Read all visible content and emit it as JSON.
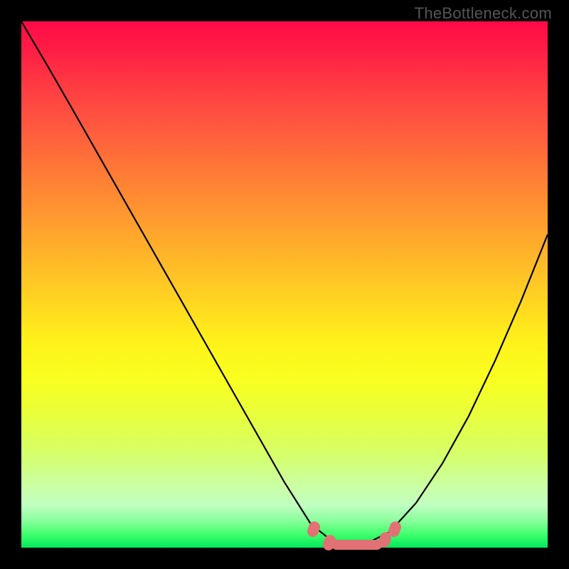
{
  "watermark": "TheBottleneck.com",
  "colors": {
    "page_bg": "#000000",
    "curve_stroke": "#000000",
    "marker_fill": "#e17174"
  },
  "chart_data": {
    "type": "line",
    "title": "",
    "xlabel": "",
    "ylabel": "",
    "xlim": [
      0,
      1
    ],
    "ylim": [
      0,
      1
    ],
    "series": [
      {
        "name": "bottleneck-curve",
        "x": [
          0.0,
          0.05,
          0.1,
          0.15,
          0.2,
          0.25,
          0.3,
          0.35,
          0.4,
          0.45,
          0.5,
          0.55,
          0.6,
          0.625,
          0.65,
          0.7,
          0.75,
          0.8,
          0.85,
          0.9,
          0.95,
          1.0
        ],
        "y": [
          1.0,
          0.915,
          0.828,
          0.74,
          0.652,
          0.564,
          0.476,
          0.388,
          0.3,
          0.212,
          0.124,
          0.045,
          0.005,
          0.0,
          0.005,
          0.03,
          0.085,
          0.16,
          0.25,
          0.355,
          0.47,
          0.595
        ]
      }
    ],
    "markers": [
      {
        "shape": "blob",
        "x": 0.555,
        "y": 0.035
      },
      {
        "shape": "blob",
        "x": 0.585,
        "y": 0.01
      },
      {
        "shape": "segment",
        "x0": 0.595,
        "y0": 0.005,
        "x1": 0.68,
        "y1": 0.005
      },
      {
        "shape": "blob",
        "x": 0.69,
        "y": 0.015
      },
      {
        "shape": "blob",
        "x": 0.71,
        "y": 0.035
      }
    ],
    "gradient_stops": [
      {
        "pos": 0.0,
        "color": "#ff0a46"
      },
      {
        "pos": 0.5,
        "color": "#ffd020"
      },
      {
        "pos": 0.8,
        "color": "#f5ff30"
      },
      {
        "pos": 1.0,
        "color": "#00e85a"
      }
    ]
  }
}
